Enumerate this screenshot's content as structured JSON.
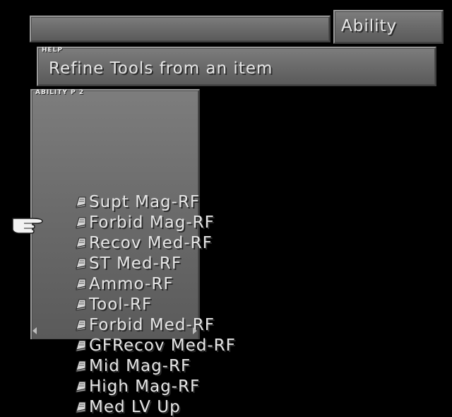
{
  "menu": {
    "title": "Ability"
  },
  "help": {
    "tag": "HELP",
    "text": "Refine Tools from an item"
  },
  "ability_list": {
    "tag": "ABILITY P 2",
    "items": [
      {
        "label": "Supt Mag-RF",
        "icon": "book-icon"
      },
      {
        "label": "Forbid Mag-RF",
        "icon": "book-icon"
      },
      {
        "label": "Recov Med-RF",
        "icon": "book-icon"
      },
      {
        "label": "ST Med-RF",
        "icon": "book-icon"
      },
      {
        "label": "Ammo-RF",
        "icon": "book-icon"
      },
      {
        "label": "Tool-RF",
        "icon": "book-icon",
        "selected": true
      },
      {
        "label": "Forbid Med-RF",
        "icon": "book-icon"
      },
      {
        "label": "GFRecov Med-RF",
        "icon": "book-icon"
      },
      {
        "label": "Mid Mag-RF",
        "icon": "book-icon"
      },
      {
        "label": "High Mag-RF",
        "icon": "book-icon"
      },
      {
        "label": "Med LV Up",
        "icon": "book-icon"
      }
    ]
  },
  "cursor": {
    "icon": "pointing-hand-icon"
  }
}
